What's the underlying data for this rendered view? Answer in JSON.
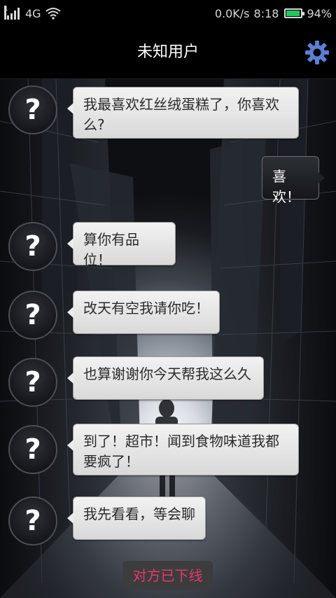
{
  "status_bar": {
    "sim_slot": "1",
    "network": "4G",
    "speed": "0.0K/s",
    "time": "8:18",
    "battery_percent": "94%",
    "battery_level": 0.94,
    "battery_color": "#22c55e"
  },
  "header": {
    "title": "未知用户",
    "settings_icon": "gear-icon",
    "accent": "#5b7fd1"
  },
  "avatar_glyph": "?",
  "messages": [
    {
      "from": "them",
      "text": "我最喜欢红丝绒蛋糕了，你喜欢么?"
    },
    {
      "from": "me",
      "text": "喜欢！"
    },
    {
      "from": "them",
      "text": "算你有品位！"
    },
    {
      "from": "them",
      "text": "改天有空我请你吃！"
    },
    {
      "from": "them",
      "text": "也算谢谢你今天帮我这么久"
    },
    {
      "from": "them",
      "text": "到了！超市！闻到食物味道我都要疯了！"
    },
    {
      "from": "them",
      "text": "我先看看，等会聊"
    }
  ],
  "footer": {
    "offline_text": "对方已下线",
    "offline_color": "#e23a6a"
  }
}
